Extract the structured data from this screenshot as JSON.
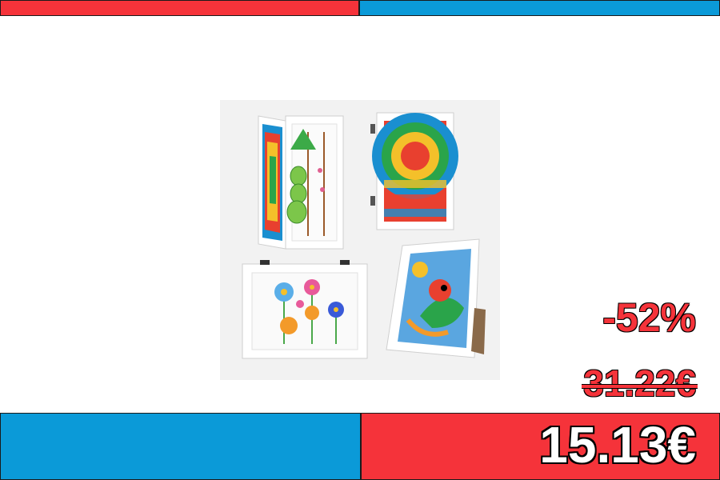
{
  "banner": {
    "discount_label": "-52%",
    "old_price": "31.22€",
    "new_price": "15.13€"
  },
  "colors": {
    "accent_red": "#f5333a",
    "accent_blue": "#0b9ad8"
  },
  "product_image": {
    "icon": "kids-art-frames-product-photo"
  }
}
